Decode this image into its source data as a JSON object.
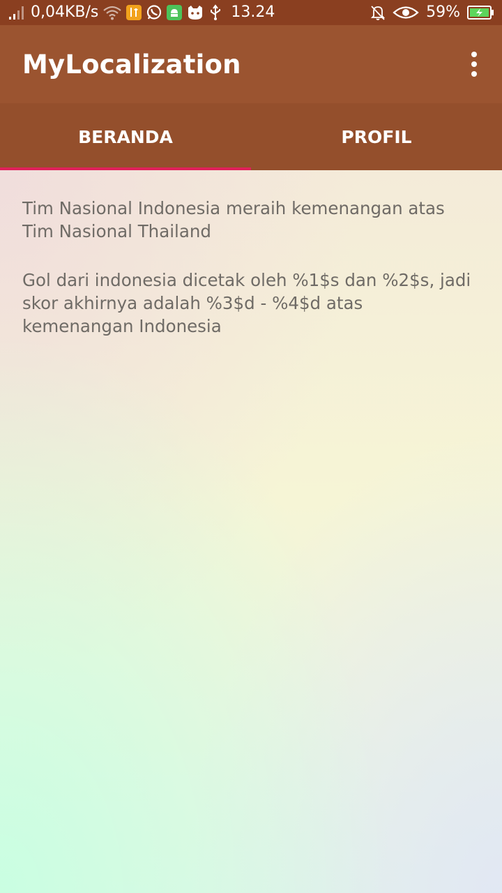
{
  "status_bar": {
    "net_speed": "0,04KB/s",
    "time": "13.24",
    "battery_percent": "59%",
    "colors": {
      "bar": "#8a3f20",
      "app_icon_orange": "#f2a21c",
      "app_icon_green": "#4cc35a",
      "battery_fill": "#5cd65c"
    }
  },
  "app_bar": {
    "title": "MyLocalization",
    "color": "#9b5430"
  },
  "tabs": [
    {
      "label": "BERANDA",
      "selected": true
    },
    {
      "label": "PROFIL",
      "selected": false
    }
  ],
  "tab_indicator_color": "#e0205a",
  "content": {
    "paragraph_1": "Tim Nasional Indonesia meraih kemenangan atas Tim Nasional Thailand",
    "paragraph_2": "Gol dari indonesia dicetak oleh %1$s dan %2$s, jadi skor akhirnya adalah %3$d - %4$d atas kemenangan Indonesia"
  }
}
